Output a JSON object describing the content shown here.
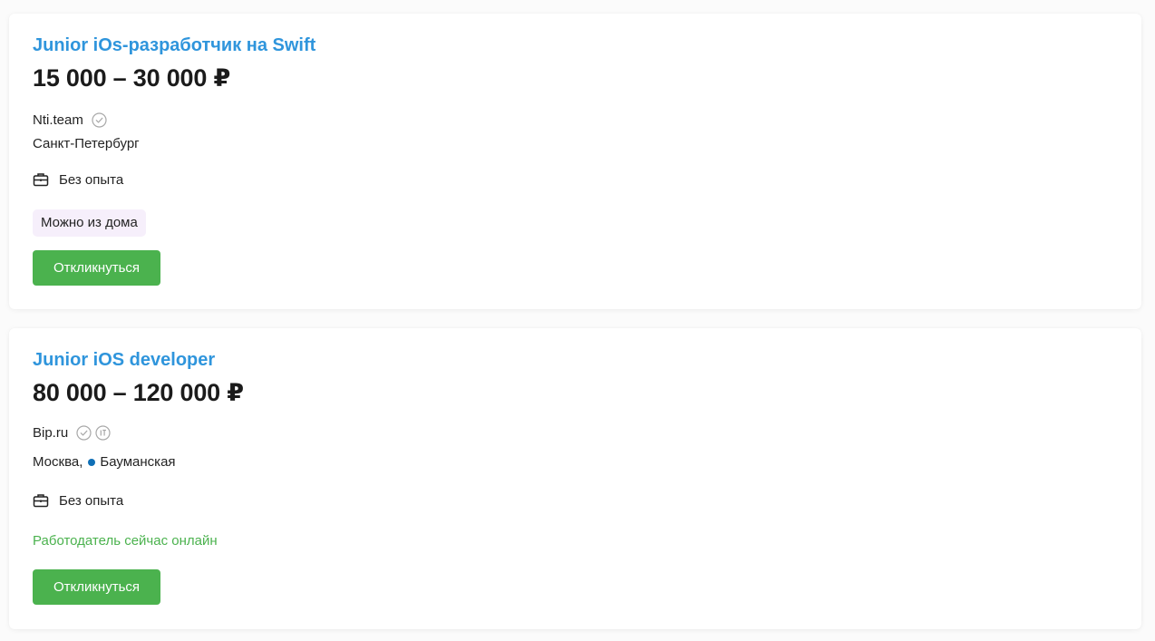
{
  "vacancies": [
    {
      "title": "Junior iOs-разработчик на Swift",
      "salary": "15 000 – 30 000 ₽",
      "company": "Nti.team",
      "badges": [
        "verified-check-icon"
      ],
      "location": "Санкт-Петербург",
      "experience": "Без опыта",
      "tag": "Можно из дома",
      "button_label": "Откликнуться"
    },
    {
      "title": "Junior iOS developer",
      "salary": "80 000 – 120 000 ₽",
      "company": "Bip.ru",
      "badges": [
        "verified-check-icon",
        "it-accredited-icon"
      ],
      "location_city": "Москва,",
      "metro": "Бауманская",
      "metro_color": "#0f6fb6",
      "experience": "Без опыта",
      "online_status": "Работодатель сейчас онлайн",
      "button_label": "Откликнуться"
    }
  ],
  "colors": {
    "title_link": "#2f95dc",
    "button": "#4bb24e",
    "online": "#4bb24e",
    "tag_bg": "#f6effb"
  }
}
